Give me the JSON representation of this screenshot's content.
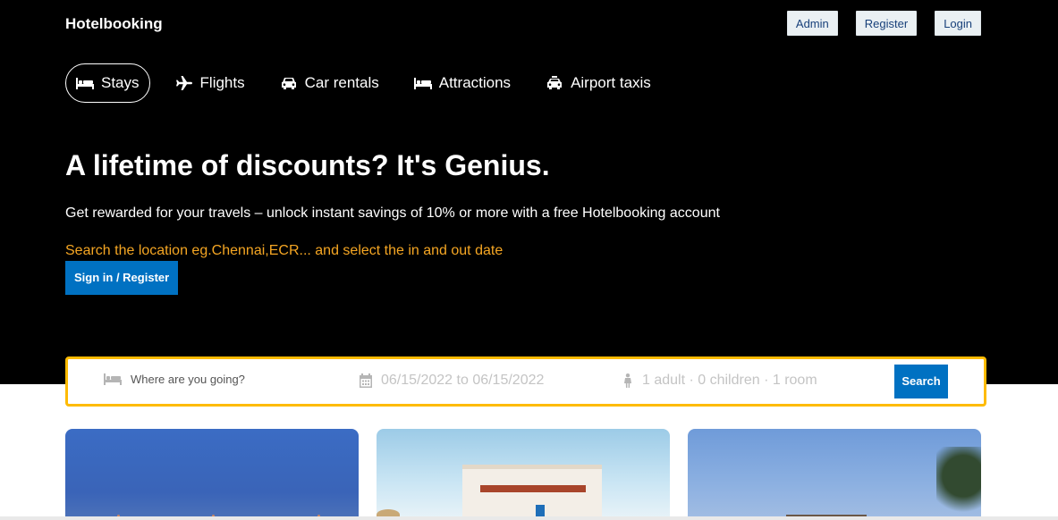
{
  "app": {
    "logo": "Hotelbooking"
  },
  "header": {
    "buttons": [
      "Admin",
      "Register",
      "Login"
    ]
  },
  "tabs": [
    {
      "label": "Stays",
      "icon": "bed-icon",
      "active": true
    },
    {
      "label": "Flights",
      "icon": "plane-icon",
      "active": false
    },
    {
      "label": "Car rentals",
      "icon": "car-icon",
      "active": false
    },
    {
      "label": "Attractions",
      "icon": "bed-icon",
      "active": false
    },
    {
      "label": "Airport taxis",
      "icon": "taxi-icon",
      "active": false
    }
  ],
  "hero": {
    "headline": "A lifetime of discounts? It's Genius.",
    "subtitle": "Get rewarded for your travels – unlock instant savings of 10% or more with a free Hotelbooking account",
    "hint": "Search the location eg.Chennai,ECR... and select the in and out date",
    "cta": "Sign in / Register"
  },
  "search": {
    "destination_placeholder": "Where are you going?",
    "dates": "06/15/2022 to 06/15/2022",
    "guests": "1 adult · 0 children · 1 room",
    "button": "Search"
  },
  "colors": {
    "hero_bg": "#000000",
    "accent": "#0071c2",
    "search_border": "#febb02",
    "hint": "#f5a623"
  }
}
